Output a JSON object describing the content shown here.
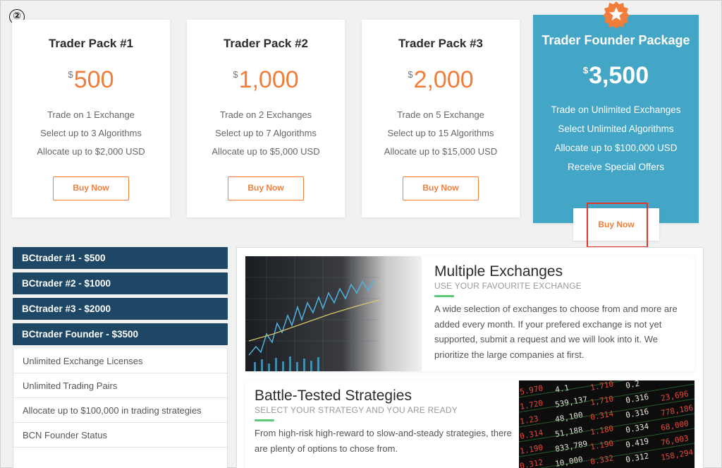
{
  "step_number": "②",
  "pricing": {
    "cards": [
      {
        "title": "Trader Pack #1",
        "currency": "$",
        "price": "500",
        "features": [
          "Trade on 1 Exchange",
          "Select up to 3 Algorithms",
          "Allocate up to $2,000 USD"
        ],
        "button": "Buy Now"
      },
      {
        "title": "Trader Pack #2",
        "currency": "$",
        "price": "1,000",
        "features": [
          "Trade on 2 Exchanges",
          "Select up to 7 Algorithms",
          "Allocate up to $5,000 USD"
        ],
        "button": "Buy Now"
      },
      {
        "title": "Trader Pack #3",
        "currency": "$",
        "price": "2,000",
        "features": [
          "Trade on 5 Exchange",
          "Select up to 15 Algorithms",
          "Allocate up to $15,000 USD"
        ],
        "button": "Buy Now"
      }
    ],
    "featured": {
      "title": "Trader Founder Package",
      "currency": "$",
      "price": "3,500",
      "features": [
        "Trade on Unlimited Exchanges",
        "Select Unlimited Algorithms",
        "Allocate up to $100,000 USD",
        "Receive Special Offers"
      ],
      "button": "Buy Now",
      "badge_icon": "star-icon"
    }
  },
  "sidebar": {
    "headers": [
      "BCtrader #1 - $500",
      "BCtrader #2 - $1000",
      "BCtrader #3 - $2000",
      "BCtrader Founder - $3500"
    ],
    "items": [
      "Unlimited Exchange Licenses",
      "Unlimited Trading Pairs",
      "Allocate up to $100,000 in trading strategies",
      "BCN Founder Status"
    ]
  },
  "features": [
    {
      "title": "Multiple Exchanges",
      "subtitle": "USE YOUR FAVOURITE EXCHANGE",
      "text": "A wide selection of exchanges to choose from and more are added every month. If your prefered exchange is not yet supported, submit a request and we will look into it. We prioritize the large companies at first."
    },
    {
      "title": "Battle-Tested Strategies",
      "subtitle": "SELECT YOUR STRATEGY AND YOU ARE READY",
      "text": "From high-risk high-reward to slow-and-steady strategies, there are plenty of options to chose from."
    }
  ],
  "ticker_board": {
    "rows": [
      [
        "5.970",
        "4.1",
        "1.710",
        "0.2"
      ],
      [
        "1.720",
        "539,137",
        "1,710",
        "0.316",
        "23,696"
      ],
      [
        "1.23",
        "48,100",
        "0.314",
        "0.316",
        "778,186"
      ],
      [
        "0.314",
        "51,188",
        "1.180",
        "0.334",
        "68,000"
      ],
      [
        "1.190",
        "833,789",
        "1.190",
        "0.419",
        "76,003"
      ],
      [
        "0.312",
        "10,000",
        "0.332",
        "0.312",
        "158,294"
      ]
    ]
  },
  "colors": {
    "accent": "#f07e3a",
    "featured_bg": "#44a6c6",
    "sidebar_head": "#1d4765",
    "green_bar": "#5dc97a",
    "highlight": "#e2352b"
  }
}
